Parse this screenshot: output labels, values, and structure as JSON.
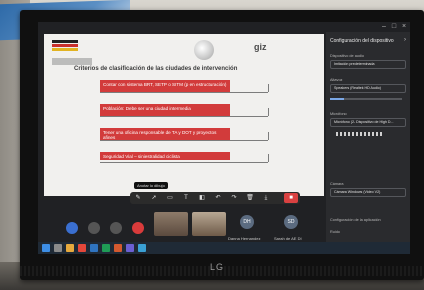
{
  "brand": {
    "logo": "LG"
  },
  "slide": {
    "title": "Criterios de clasificación de las ciudades de intervención",
    "brand_giz": "giz",
    "criteria": [
      "Contar con sistema BRT, SETP o SITM (p en estructuración)",
      "Población: Debe ser una ciudad intermedia",
      "Tener una oficina responsable de TA y DOT y proyectos afines",
      "Seguridad Vial – siniestralidad ciclista"
    ],
    "colors": {
      "criteria_box": "#d23b3b",
      "background": "#f1f0ee"
    }
  },
  "meeting_toolbar": {
    "tooltip": "Anotar lo dibujo",
    "icons": [
      "pen-icon",
      "mouse-icon",
      "rectangle-icon",
      "text-icon",
      "eraser-icon",
      "undo-icon",
      "redo-icon",
      "trash-icon",
      "save-icon",
      "stop-icon"
    ]
  },
  "participants": [
    {
      "name": "",
      "initials": ""
    },
    {
      "name": "Danna Hernandez",
      "initials": "DH"
    },
    {
      "name": "Sarah de AE DI",
      "initials": "SD"
    }
  ],
  "settings_panel": {
    "title": "Configuración del dispositivo",
    "speaker_label": "Dispositivo de audio",
    "speaker_value": "Imitación predeterminada",
    "mic_label": "Altavoz",
    "mic_value": "Speakers (Realtek HD Audio)",
    "input_label": "Micrófono",
    "input_value": "Micrófono (2- Dispositivo de High D...",
    "camera_label": "Cámara",
    "camera_value": "Cámara Windows (Video V2)",
    "config_label": "Configuración de la aplicación",
    "extra_label": "Ruido"
  }
}
